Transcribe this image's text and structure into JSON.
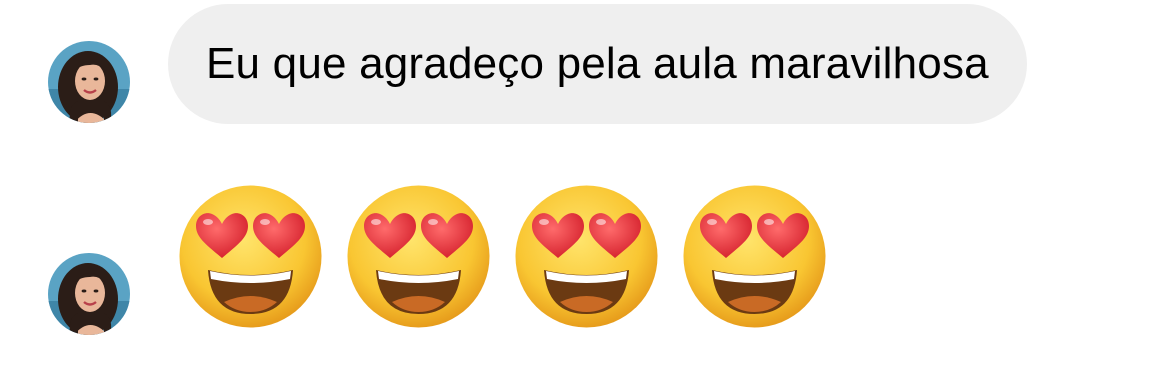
{
  "messages": [
    {
      "type": "text",
      "sender_avatar": "avatar-woman",
      "text": "Eu que agradeço pela aula maravilhosa"
    },
    {
      "type": "emoji",
      "sender_avatar": "avatar-woman",
      "emojis": [
        "heart-eyes-emoji",
        "heart-eyes-emoji",
        "heart-eyes-emoji",
        "heart-eyes-emoji"
      ]
    }
  ],
  "colors": {
    "bubble_bg": "#efefef",
    "text": "#000000",
    "emoji_face": "#f7c23a",
    "emoji_heart": "#e8323c"
  }
}
